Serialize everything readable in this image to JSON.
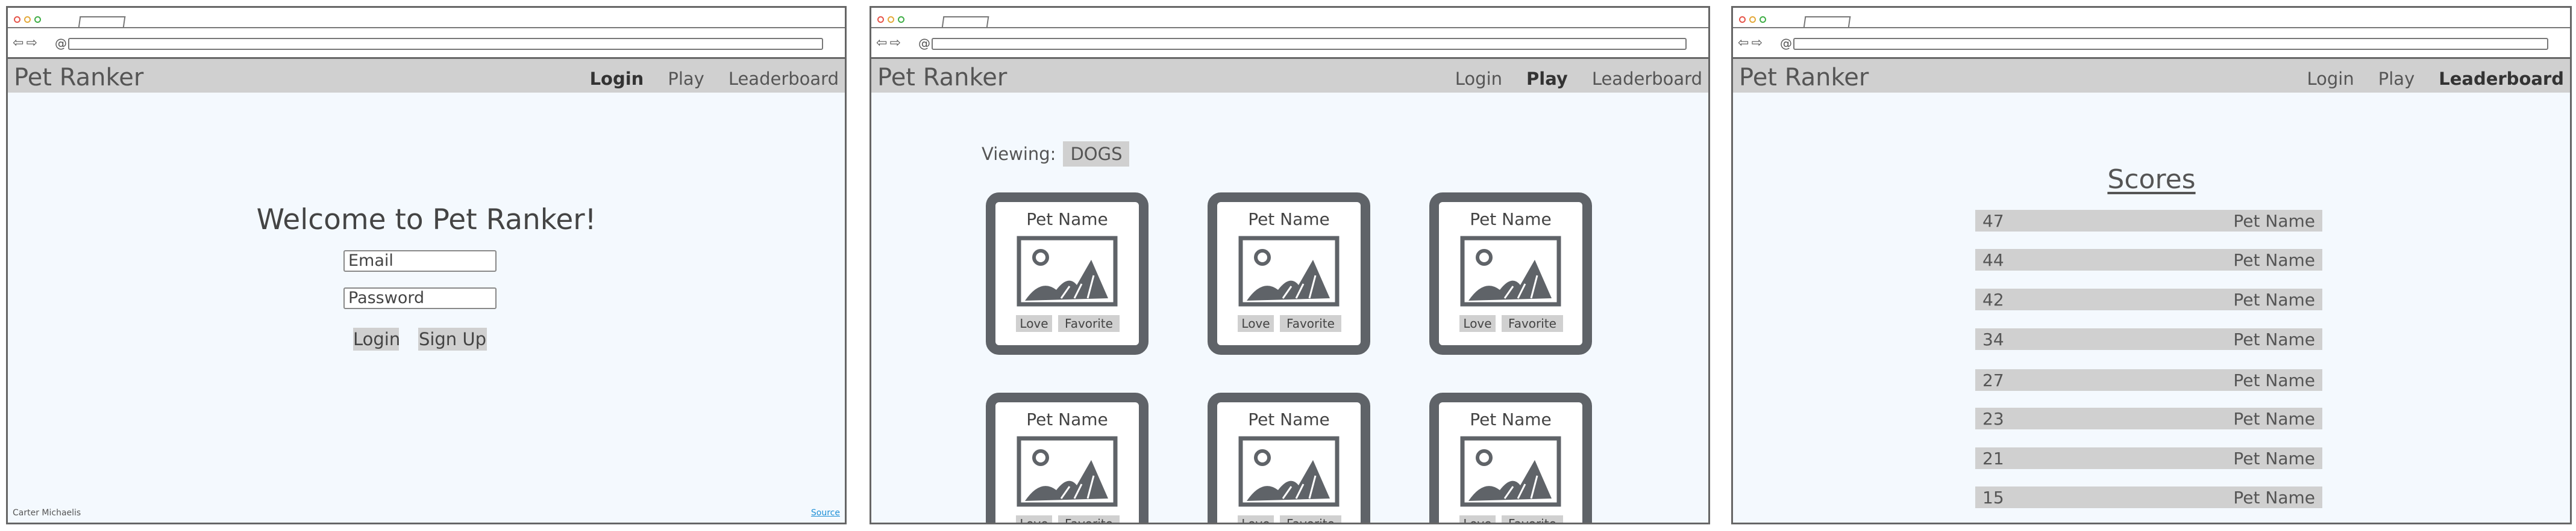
{
  "app_title": "Pet Ranker",
  "nav": {
    "login": "Login",
    "play": "Play",
    "leaderboard": "Leaderboard"
  },
  "login_page": {
    "welcome": "Welcome to Pet Ranker!",
    "email_placeholder": "Email",
    "password_placeholder": "Password",
    "login_button": "Login",
    "signup_button": "Sign Up",
    "author": "Carter Michaelis",
    "source_link": "Source"
  },
  "play_page": {
    "viewing_label": "Viewing:",
    "viewing_value": "DOGS",
    "cards": [
      {
        "name": "Pet Name",
        "love": "Love",
        "favorite": "Favorite"
      },
      {
        "name": "Pet Name",
        "love": "Love",
        "favorite": "Favorite"
      },
      {
        "name": "Pet Name",
        "love": "Love",
        "favorite": "Favorite"
      },
      {
        "name": "Pet Name",
        "love": "Love",
        "favorite": "Favorite"
      },
      {
        "name": "Pet Name",
        "love": "Love",
        "favorite": "Favorite"
      },
      {
        "name": "Pet Name",
        "love": "Love",
        "favorite": "Favorite"
      }
    ]
  },
  "leaderboard_page": {
    "title": "Scores",
    "rows": [
      {
        "score": "47",
        "name": "Pet Name"
      },
      {
        "score": "44",
        "name": "Pet Name"
      },
      {
        "score": "42",
        "name": "Pet Name"
      },
      {
        "score": "34",
        "name": "Pet Name"
      },
      {
        "score": "27",
        "name": "Pet Name"
      },
      {
        "score": "23",
        "name": "Pet Name"
      },
      {
        "score": "21",
        "name": "Pet Name"
      },
      {
        "score": "15",
        "name": "Pet Name"
      }
    ]
  },
  "icons": {
    "back": "back-arrow-icon",
    "forward": "forward-arrow-icon",
    "address": "globe-icon",
    "pet_image": "image-placeholder-icon"
  },
  "colors": {
    "page_bg": "#f4f9fe",
    "bar_gray": "#d0d0d0",
    "card_border": "#5f6368",
    "link_blue": "#1e8fd6"
  }
}
